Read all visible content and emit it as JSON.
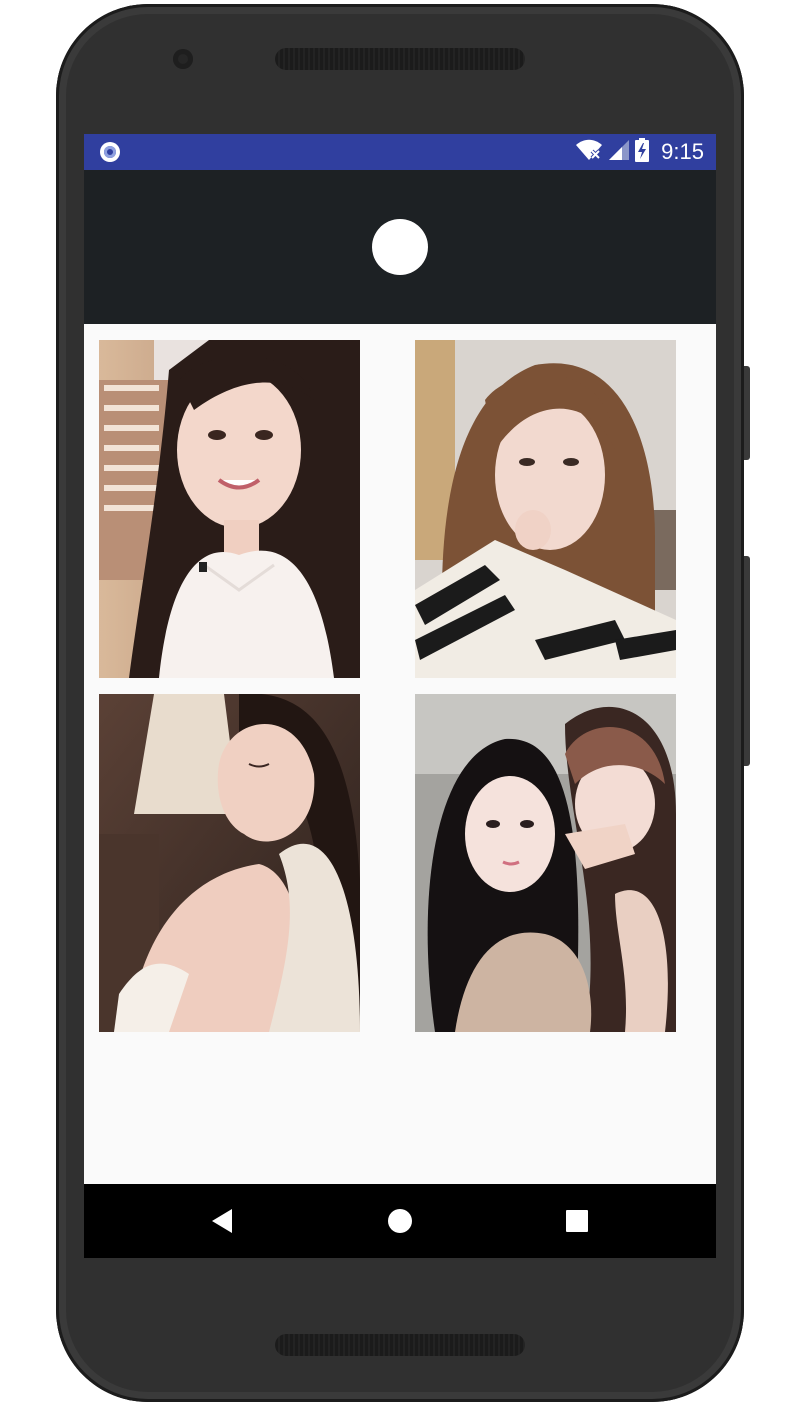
{
  "status_bar": {
    "time": "9:15",
    "background": "#303f9f",
    "icons": [
      "circle-notification-icon",
      "wifi-off-icon",
      "cellular-signal-icon",
      "battery-charging-icon"
    ]
  },
  "toolbar": {
    "background": "#1d2124",
    "avatar_icon": "avatar-circle-icon"
  },
  "gallery": {
    "columns": 2,
    "items": [
      {
        "name": "photo-1",
        "description_icon": "photo-thumbnail"
      },
      {
        "name": "photo-2",
        "description_icon": "photo-thumbnail"
      },
      {
        "name": "photo-3",
        "description_icon": "photo-thumbnail"
      },
      {
        "name": "photo-4",
        "description_icon": "photo-thumbnail"
      }
    ]
  },
  "nav_bar": {
    "buttons": [
      "back-icon",
      "home-icon",
      "recents-icon"
    ]
  }
}
